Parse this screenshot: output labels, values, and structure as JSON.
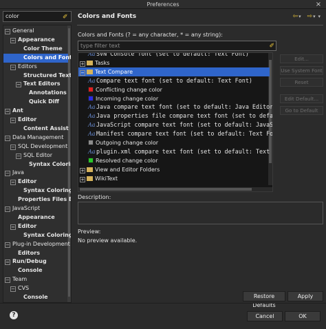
{
  "window": {
    "title": "Preferences",
    "close_glyph": "×"
  },
  "left": {
    "search_value": "color",
    "tree": [
      {
        "label": "General",
        "level": 0,
        "exp": "−",
        "bold": false
      },
      {
        "label": "Appearance",
        "level": 1,
        "exp": "−",
        "bold": true
      },
      {
        "label": "Color Theme",
        "level": 2,
        "exp": "",
        "bold": true
      },
      {
        "label": "Colors and Fonts",
        "level": 2,
        "exp": "",
        "bold": true,
        "selected": true
      },
      {
        "label": "Editors",
        "level": 1,
        "exp": "−",
        "bold": false
      },
      {
        "label": "Structured Text",
        "level": 2,
        "exp": "",
        "bold": true
      },
      {
        "label": "Text Editors",
        "level": 2,
        "exp": "−",
        "bold": true
      },
      {
        "label": "Annotations",
        "level": 3,
        "exp": "",
        "bold": true
      },
      {
        "label": "Quick Diff",
        "level": 3,
        "exp": "",
        "bold": true
      },
      {
        "label": "Ant",
        "level": 0,
        "exp": "−",
        "bold": true
      },
      {
        "label": "Editor",
        "level": 1,
        "exp": "−",
        "bold": true
      },
      {
        "label": "Content Assist",
        "level": 2,
        "exp": "",
        "bold": true
      },
      {
        "label": "Data Management",
        "level": 0,
        "exp": "−",
        "bold": false
      },
      {
        "label": "SQL Development",
        "level": 1,
        "exp": "−",
        "bold": false
      },
      {
        "label": "SQL Editor",
        "level": 2,
        "exp": "−",
        "bold": false
      },
      {
        "label": "Syntax Coloring",
        "level": 3,
        "exp": "",
        "bold": true
      },
      {
        "label": "Java",
        "level": 0,
        "exp": "−",
        "bold": false
      },
      {
        "label": "Editor",
        "level": 1,
        "exp": "−",
        "bold": true
      },
      {
        "label": "Syntax Coloring",
        "level": 2,
        "exp": "",
        "bold": true
      },
      {
        "label": "Properties Files Ed",
        "level": 1,
        "exp": "",
        "bold": true
      },
      {
        "label": "JavaScript",
        "level": 0,
        "exp": "−",
        "bold": false
      },
      {
        "label": "Appearance",
        "level": 1,
        "exp": "",
        "bold": true
      },
      {
        "label": "Editor",
        "level": 1,
        "exp": "−",
        "bold": true
      },
      {
        "label": "Syntax Coloring",
        "level": 2,
        "exp": "",
        "bold": true
      },
      {
        "label": "Plug-in Development",
        "level": 0,
        "exp": "−",
        "bold": false
      },
      {
        "label": "Editors",
        "level": 1,
        "exp": "",
        "bold": true
      },
      {
        "label": "Run/Debug",
        "level": 0,
        "exp": "−",
        "bold": true
      },
      {
        "label": "Console",
        "level": 1,
        "exp": "",
        "bold": true
      },
      {
        "label": "Team",
        "level": 0,
        "exp": "−",
        "bold": false
      },
      {
        "label": "CVS",
        "level": 1,
        "exp": "−",
        "bold": false
      },
      {
        "label": "Console",
        "level": 2,
        "exp": "",
        "bold": true
      }
    ]
  },
  "right": {
    "heading": "Colors and Fonts",
    "nav": {
      "back_glyph": "⇦",
      "forward_glyph": "⇨",
      "dropdown_glyph": "▾",
      "menu_glyph": "▾"
    },
    "description": "Colors and Fonts (? = any character, * = any string):",
    "filter_placeholder": "type filter text",
    "list_items": [
      {
        "kind": "font",
        "text": "SVN Console font (set to default: Text Font)",
        "indent": 1,
        "partial": true
      },
      {
        "kind": "folder",
        "text": "Tasks",
        "exp": "+",
        "indent": 0
      },
      {
        "kind": "folder",
        "text": "Text Compare",
        "exp": "−",
        "indent": 0,
        "selected": true
      },
      {
        "kind": "font",
        "text": "Compare text font (set to default: Text Font)",
        "indent": 1
      },
      {
        "kind": "color",
        "text": "Conflicting change color",
        "color": "#e01f1f",
        "indent": 1
      },
      {
        "kind": "color",
        "text": "Incoming change color",
        "color": "#2a2ae0",
        "indent": 1
      },
      {
        "kind": "font",
        "text": "Java compare text font (set to default: Java Editor Text Font)",
        "indent": 1
      },
      {
        "kind": "font",
        "text": "Java properties file compare text font (set to default: Java Editor Text Font)",
        "indent": 1
      },
      {
        "kind": "font",
        "text": "JavaScript compare text font (set to default: JavaScript Editor Text Font)",
        "indent": 1
      },
      {
        "kind": "font",
        "text": "Manifest compare text font (set to default: Text Font)",
        "indent": 1
      },
      {
        "kind": "color",
        "text": "Outgoing change color",
        "color": "#8c8c8c",
        "indent": 1
      },
      {
        "kind": "font",
        "text": "plugin.xml compare text font (set to default: Text Font)",
        "indent": 1
      },
      {
        "kind": "color",
        "text": "Resolved change color",
        "color": "#28c828",
        "indent": 1
      },
      {
        "kind": "folder",
        "text": "View and Editor Folders",
        "exp": "+",
        "indent": 0
      },
      {
        "kind": "folder",
        "text": "WikiText",
        "exp": "+",
        "indent": 0
      }
    ],
    "side_buttons": [
      "Edit...",
      "Use System Font",
      "Reset",
      "Edit Default...",
      "Go to Default"
    ],
    "description_label": "Description:",
    "preview_label": "Preview:",
    "preview_text": "No preview available.",
    "restore_defaults": "Restore Defaults",
    "apply": "Apply"
  },
  "footer": {
    "help_glyph": "?",
    "cancel": "Cancel",
    "ok": "OK"
  },
  "colors": {
    "selection": "#2f65ca",
    "accent_icon": "#e8c43a",
    "background": "#2b2b2b"
  }
}
